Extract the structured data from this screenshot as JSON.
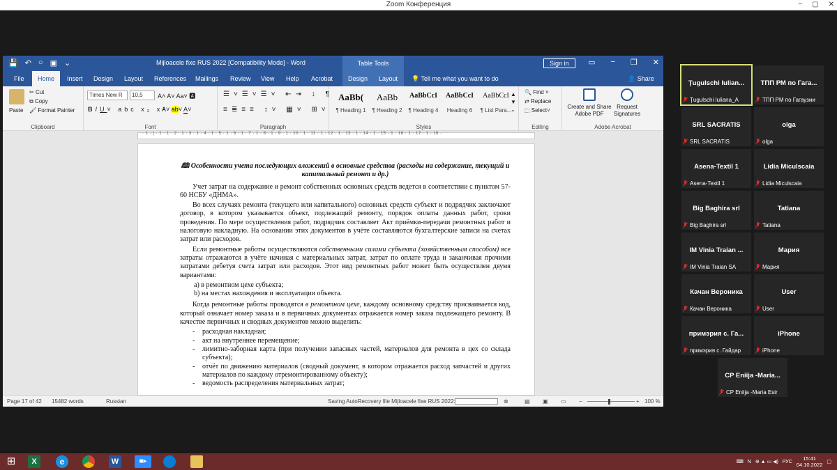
{
  "zoom": {
    "title": "Zoom Конференция",
    "controls": [
      "−",
      "▢",
      "✕"
    ]
  },
  "word": {
    "window_title": "Mijloacele fixe RUS 2022 [Compatibility Mode] - Word",
    "table_tools": "Table Tools",
    "sign_in": "Sign in",
    "tabs": [
      "File",
      "Home",
      "Insert",
      "Design",
      "Layout",
      "References",
      "Mailings",
      "Review",
      "View",
      "Help",
      "Acrobat",
      "Design",
      "Layout"
    ],
    "tell_me": "Tell me what you want to do",
    "share": "Share",
    "ribbon": {
      "clipboard": {
        "paste": "Paste",
        "cut": "Cut",
        "copy": "Copy",
        "format_painter": "Format Painter",
        "label": "Clipboard"
      },
      "font": {
        "family": "Times New R",
        "size": "10,5",
        "label": "Font"
      },
      "paragraph": {
        "label": "Paragraph"
      },
      "styles": {
        "items": [
          {
            "sample": "AaBb(",
            "name": "¶ Heading 1"
          },
          {
            "sample": "AaBb",
            "name": "¶ Heading 2"
          },
          {
            "sample": "AaBbCcI",
            "name": "¶ Heading 4"
          },
          {
            "sample": "AaBbCcI",
            "name": "Heading 6"
          },
          {
            "sample": "AaBbCcI",
            "name": "¶ List Para..."
          }
        ],
        "label": "Styles"
      },
      "editing": {
        "find": "Find",
        "replace": "Replace",
        "select": "Select",
        "label": "Editing"
      },
      "acrobat": {
        "create": "Create and Share Adobe PDF",
        "request": "Request Signatures",
        "label": "Adobe Acrobat"
      }
    },
    "ruler_ticks": "· 1 · | · 1 · 1 · 2 · 1 · 3 · 1 · 4 · 1 · 5 · 1 · 6 · 1 · 7 · 1 · 8 · 1 · 9 · 1 · 10 · 1 · 11 · 1 · 12 · 1 · 13 · 1 · 14 · 1 · 15 · 1 · 16 · 1 · 17 · 1 · 18 ·",
    "document": {
      "heading": "🕮 Особенности учета последующих вложений в основные средства (расходы на содержание, текущий и капитальный ремонт и др.)",
      "p1": "Учет затрат на содержание и ремонт собственных основных средств ведется в соответствии с пунктом 57-60 НСБУ «ДНМА».",
      "p2": "Во всех случаях ремонта (текущего или капитального) основных средств субъект и подрядчик заключают договор, в котором указывается объект, подлежащий ремонту, порядок оплаты данных работ, сроки проведения. По мере осуществления работ, подрядчик составляет Акт приёмки-передачи ремонтных работ и налоговую накладную. На основании этих документов в учёте составляются бухгалтерские записи на счетах затрат или расходов.",
      "p3_a": "Если ремонтные работы осуществляются ",
      "p3_em": "собственными силами субъекта (хозяйственным способом)",
      "p3_b": " все затраты отражаются в учёте начиная с материальных затрат, затрат по оплате труда и заканчивая прочими затратами дебетуя счета затрат или расходов. Этот вид ремонтных работ может быть осуществлен двумя вариантами:",
      "variant_a": "a) в ремонтном цехе субъекта;",
      "variant_b": "b) на местах нахождения и эксплуатации объекта.",
      "p4_a": "Когда ремонтные работы проводятся ",
      "p4_em": "в ремонтном цехе,",
      "p4_b": " каждому основному средству присваивается код, который означает номер заказа и в первичных документах отражается номер заказа подлежащего ремонту. В качестве первичных и сводных документов можно выделить:",
      "list": [
        "расходная накладная;",
        "акт на внутреннее перемещение;",
        "лимитно-заборная карта (при получении запасных частей, материалов для ремонта в цех со склада субъекта);",
        "отчёт по движению материалов (сводный документ, в котором отражается расход запчастей и других материалов по каждому отремонтированному объекту);",
        "ведомость распределения материальных затрат;"
      ]
    },
    "status": {
      "page": "Page 17 of 42",
      "words": "15482 words",
      "language": "Russian",
      "saving": "Saving AutoRecovery file Mijloacele fixe RUS 2022:",
      "zoom": "100 %"
    }
  },
  "participants": [
    {
      "name": "Ţugulschi  Iulian...",
      "label": "Ţugulschi Iuliana_A",
      "active": true
    },
    {
      "name": "ТПП РМ по Гага...",
      "label": "ТПП РМ по Гагаузии"
    },
    {
      "name": "SRL SACRATIS",
      "label": "SRL SACRATIS"
    },
    {
      "name": "olga",
      "label": "olga"
    },
    {
      "name": "Asena-Textil 1",
      "label": "Asena-Textil 1"
    },
    {
      "name": "Lidia  Miculscaia",
      "label": "Lidia  Miculscaia"
    },
    {
      "name": "Big Baghira srl",
      "label": "Big Baghira srl"
    },
    {
      "name": "Tatiana",
      "label": "Tatiana"
    },
    {
      "name": "IM Vinia Traian ...",
      "label": "IM Vinia Traian SA"
    },
    {
      "name": "Мария",
      "label": "Мария"
    },
    {
      "name": "Качан Вероника",
      "label": "Качан Вероника"
    },
    {
      "name": "User",
      "label": "User"
    },
    {
      "name": "примэрия  с. Га...",
      "label": "примэрия с. Гайдар"
    },
    {
      "name": "iPhone",
      "label": "iPhone"
    },
    {
      "name": "CP Eniija  -Maria...",
      "label": "CP Eniija -Maria Esir"
    }
  ],
  "taskbar": {
    "language": "РУС",
    "time": "15:41",
    "date": "04.10.2022",
    "colors": {
      "bg": "#6b2b2b",
      "excel": "#1d6f42",
      "word": "#2b579a",
      "zoom": "#2d8cff",
      "edge": "#0c7cd5"
    }
  }
}
